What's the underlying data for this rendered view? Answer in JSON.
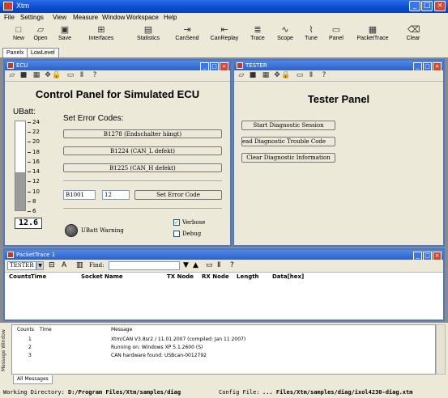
{
  "window": {
    "title": "Xtm"
  },
  "menu": [
    "File",
    "Settings",
    "View",
    "Measure",
    "Window",
    "Workspace",
    "Help"
  ],
  "toolbar": [
    {
      "label": "New",
      "icon": "new-file-icon"
    },
    {
      "label": "Open",
      "icon": "open-folder-icon"
    },
    {
      "label": "Save",
      "icon": "save-icon"
    },
    {
      "label": "Interfaces",
      "icon": "interfaces-icon"
    },
    {
      "label": "Statistics",
      "icon": "statistics-icon"
    },
    {
      "label": "CanSend",
      "icon": "cansend-icon"
    },
    {
      "label": "CanReplay",
      "icon": "canreplay-icon"
    },
    {
      "label": "Trace",
      "icon": "trace-icon"
    },
    {
      "label": "Scope",
      "icon": "scope-icon"
    },
    {
      "label": "Tune",
      "icon": "tune-icon"
    },
    {
      "label": "Panel",
      "icon": "panel-icon"
    },
    {
      "label": "PacketTrace",
      "icon": "packettrace-icon"
    },
    {
      "label": "Clear",
      "icon": "clear-icon"
    }
  ],
  "tabs": [
    "Panelx",
    "LowLevel"
  ],
  "ecu": {
    "window_title": "ECU",
    "title": "Control Panel for Simulated ECU",
    "ubatt_label": "UBatt:",
    "scale": [
      "24",
      "22",
      "20",
      "18",
      "16",
      "14",
      "12",
      "10",
      "8",
      "6"
    ],
    "ubatt_value": "12.6",
    "ubatt_level": 0.43,
    "set_error_label": "Set Error Codes:",
    "error_buttons": [
      "B1278 (Endschalter hängt)",
      "B1224 (CAN_L defekt)",
      "B1225 (CAN_H defekt)"
    ],
    "code_input": "B1001",
    "num_input": "12",
    "set_error_button": "Set Error Code",
    "warning_label": "UBatt Warning",
    "verbose_label": "Verbose",
    "verbose_checked": true,
    "debug_label": "Debug",
    "debug_checked": false
  },
  "tester": {
    "window_title": "TESTER",
    "title": "Tester Panel",
    "buttons": [
      "Start Diagnostic Session",
      "ead  Diagnostic Trouble Code",
      "Clear Diagnostic Information"
    ]
  },
  "packettrace": {
    "window_title": "PacketTrace 1",
    "select_value": "TESTER",
    "find_label": "Find:",
    "find_value": "",
    "columns": [
      "Counts",
      "Time",
      "Socket Name",
      "TX Node",
      "RX Node",
      "Length",
      "Data[hex]"
    ]
  },
  "messages": {
    "side_label": "Message Window",
    "columns": [
      "Counts",
      "Time",
      "Message"
    ],
    "rows": [
      {
        "count": "1",
        "message": "Xtm/CAN V3.8sr2 / 11.01.2007 (compiled: Jan 11 2007)"
      },
      {
        "count": "2",
        "message": "Running on: Windows XP 5.1.2600 (S)"
      },
      {
        "count": "3",
        "message": "CAN hardware found: USBcan-0012792"
      }
    ],
    "tab": "All Messages"
  },
  "status": {
    "dir_label": "Working Directory:",
    "dir_value": "D:/Program Files/Xtm/samples/diag",
    "cfg_label": "Config File:",
    "cfg_value": "... Files/Xtm/samples/diag/ixol4230-diag.xtm"
  },
  "colors": {
    "title_bar": "#0a4bd0",
    "led_red": "#ff2222",
    "gauge_green": "#2d8f2d"
  }
}
